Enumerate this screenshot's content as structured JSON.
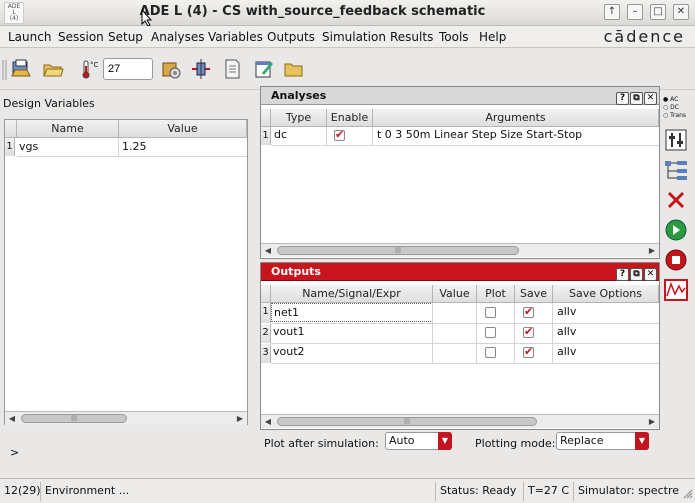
{
  "window": {
    "app_icon_text": "ADE\nL\n(4)",
    "title": "ADE L (4) - CS with_source_feedback schematic",
    "controls": [
      "↑",
      "–",
      "□",
      "✕"
    ]
  },
  "menu": {
    "items": [
      "Launch",
      "Session",
      "Setup",
      "Analyses",
      "Variables",
      "Outputs",
      "Simulation",
      "Results",
      "Tools",
      "Help"
    ],
    "brand": "cādence"
  },
  "toolbar": {
    "temperature": "27",
    "temp_unit": "°C"
  },
  "design_variables": {
    "label": "Design Variables",
    "columns": [
      "Name",
      "Value"
    ],
    "rows": [
      {
        "num": "1",
        "name": "vgs",
        "value": "1.25"
      }
    ],
    "scroll_thumb": "|||"
  },
  "prompt": ">",
  "analyses": {
    "title": "Analyses",
    "columns": [
      "Type",
      "Enable",
      "Arguments"
    ],
    "rows": [
      {
        "num": "1",
        "type": "dc",
        "enabled": true,
        "arguments": "t 0 3 50m Linear Step Size Start-Stop"
      }
    ],
    "scroll_thumb": "|||"
  },
  "outputs": {
    "title": "Outputs",
    "columns": [
      "Name/Signal/Expr",
      "Value",
      "Plot",
      "Save",
      "Save Options"
    ],
    "rows": [
      {
        "num": "1",
        "name": "net1",
        "value": "",
        "plot": false,
        "save": true,
        "options": "allv"
      },
      {
        "num": "2",
        "name": "vout1",
        "value": "",
        "plot": false,
        "save": true,
        "options": "allv"
      },
      {
        "num": "3",
        "name": "vout2",
        "value": "",
        "plot": false,
        "save": true,
        "options": "allv"
      }
    ],
    "scroll_thumb": "|||"
  },
  "panel_buttons": [
    "?",
    "⧉",
    "✕"
  ],
  "sidebar": {
    "analysis_radio": [
      "AC",
      "DC",
      "Trans"
    ]
  },
  "bottom": {
    "plot_after_label": "Plot after simulation:",
    "plot_after_value": "Auto",
    "plotting_mode_label": "Plotting mode:",
    "plotting_mode_value": "Replace"
  },
  "status": {
    "line": "12(29)",
    "message": "Environment ...",
    "state": "Status: Ready",
    "temperature": "T=27 C",
    "simulator": "Simulator: spectre"
  },
  "colors": {
    "accent_red": "#c4141f",
    "outputs_header": "#c8141c",
    "analyses_header": "#d8d8d8"
  }
}
